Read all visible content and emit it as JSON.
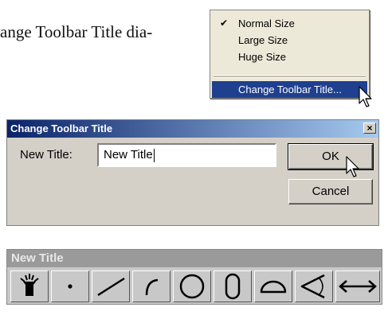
{
  "book_text": "ange Toolbar Title dia-",
  "context_menu": {
    "items": [
      {
        "label": "Normal Size",
        "checked": true
      },
      {
        "label": "Large Size",
        "checked": false
      },
      {
        "label": "Huge Size",
        "checked": false
      }
    ],
    "highlighted_item": "Change Toolbar Title...",
    "check_glyph": "✔"
  },
  "dialog": {
    "title": "Change Toolbar Title",
    "close_glyph": "×",
    "field_label": "New Title:",
    "field_value": "New Title",
    "ok_label": "OK",
    "cancel_label": "Cancel"
  },
  "toolbar": {
    "title": "New Title",
    "tools": [
      {
        "icon": "magic-hat-icon"
      },
      {
        "icon": "point-icon"
      },
      {
        "icon": "line-icon"
      },
      {
        "icon": "arc-icon"
      },
      {
        "icon": "circle-icon"
      },
      {
        "icon": "ellipse-icon"
      },
      {
        "icon": "semicircle-icon"
      },
      {
        "icon": "angle-icon"
      },
      {
        "icon": "distance-icon"
      }
    ]
  },
  "colors": {
    "dialog_title_start": "#0a246a",
    "dialog_title_end": "#a6caf0",
    "menu_highlight": "#1f3f8f",
    "toolbar_title_bg": "#9a9a9a"
  }
}
